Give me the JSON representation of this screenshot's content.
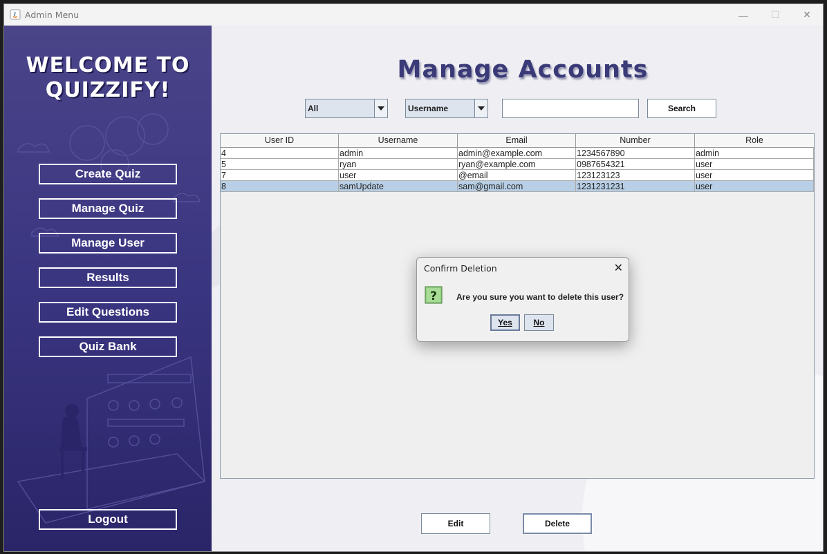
{
  "window": {
    "title": "Admin Menu",
    "minimize_glyph": "—",
    "maximize_glyph": "☐",
    "close_glyph": "✕"
  },
  "sidebar": {
    "welcome": "WELCOME TO QUIZZIFY!",
    "buttons": [
      "Create Quiz",
      "Manage Quiz",
      "Manage User",
      "Results",
      "Edit Questions",
      "Quiz Bank"
    ],
    "logout": "Logout",
    "gradient_top": "#4a4489",
    "gradient_bottom": "#2a2568"
  },
  "main": {
    "title": "Manage Accounts",
    "filter_role": "All",
    "filter_field": "Username",
    "search_value": "",
    "search_label": "Search",
    "edit_label": "Edit",
    "delete_label": "Delete"
  },
  "table": {
    "columns": [
      "User ID",
      "Username",
      "Email",
      "Number",
      "Role"
    ],
    "rows": [
      [
        "4",
        "admin",
        "admin@example.com",
        "1234567890",
        "admin"
      ],
      [
        "5",
        "ryan",
        "ryan@example.com",
        "0987654321",
        "user"
      ],
      [
        "7",
        "user",
        "@email",
        "123123123",
        "user"
      ],
      [
        "8",
        "samUpdate",
        "sam@gmail.com",
        "1231231231",
        "user"
      ]
    ],
    "selected_row": 3,
    "selection_color": "#b8cfe5"
  },
  "dialog": {
    "title": "Confirm Deletion",
    "close_glyph": "✕",
    "icon": "question-icon",
    "message": "Are you sure you want to delete this user?",
    "yes_label": "Yes",
    "no_label": "No"
  }
}
